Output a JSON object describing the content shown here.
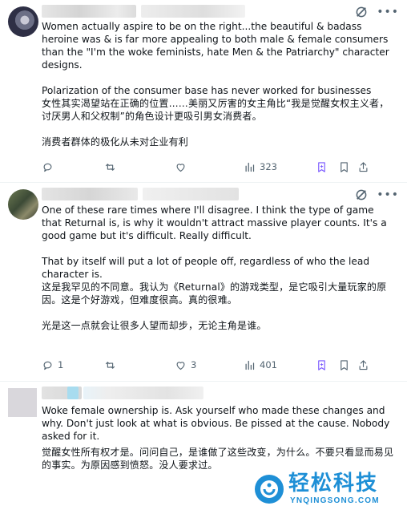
{
  "posts": [
    {
      "paragraphs": [
        "Women actually aspire to be on the right...the beautiful & badass heroine was & is far more appealing to both male & female consumers than the \"I'm the woke feminists, hate Men & the Patriarchy\" character designs.",
        "",
        "Polarization of the consumer base has never worked for businesses",
        "女性其实渴望站在正确的位置……美丽又厉害的女主角比“我是觉醒女权主义者，讨厌男人和父权制”的角色设计更吸引男女消费者。",
        "",
        "消费者群体的极化从未对企业有利"
      ],
      "replies": "",
      "reposts": "",
      "likes": "",
      "views": "323"
    },
    {
      "paragraphs": [
        "One of these rare times where I'll disagree. I think the type of game that Returnal is, is why it wouldn't attract massive player counts. It's a good game but it's difficult. Really difficult.",
        "",
        "That by itself will put a lot of people off, regardless of who the lead character is.",
        "这是我罕见的不同意。我认为《Returnal》的游戏类型，是它吸引大量玩家的原因。这是个好游戏，但难度很高。真的很难。",
        "",
        "光是这一点就会让很多人望而却步，无论主角是谁。"
      ],
      "replies": "1",
      "reposts": "",
      "likes": "3",
      "views": "401"
    },
    {
      "paragraphs": [
        "Woke female ownership is. Ask yourself who made these changes and why. Don't just look at what is obvious. Be pissed at the cause. Nobody asked for it.",
        "觉醒女性所有权才是。问问自己，是谁做了这些改变，为什么。不要只看显而易见的事实。为原因感到愤怒。没人要求过。"
      ]
    }
  ],
  "watermark": {
    "name": "轻松科技",
    "domain": "YNQINGSONG.COM"
  },
  "colors": {
    "text": "#0f1419",
    "muted": "#536471",
    "accent_purple": "#7856ff",
    "watermark_blue": "#1e8fd6"
  }
}
